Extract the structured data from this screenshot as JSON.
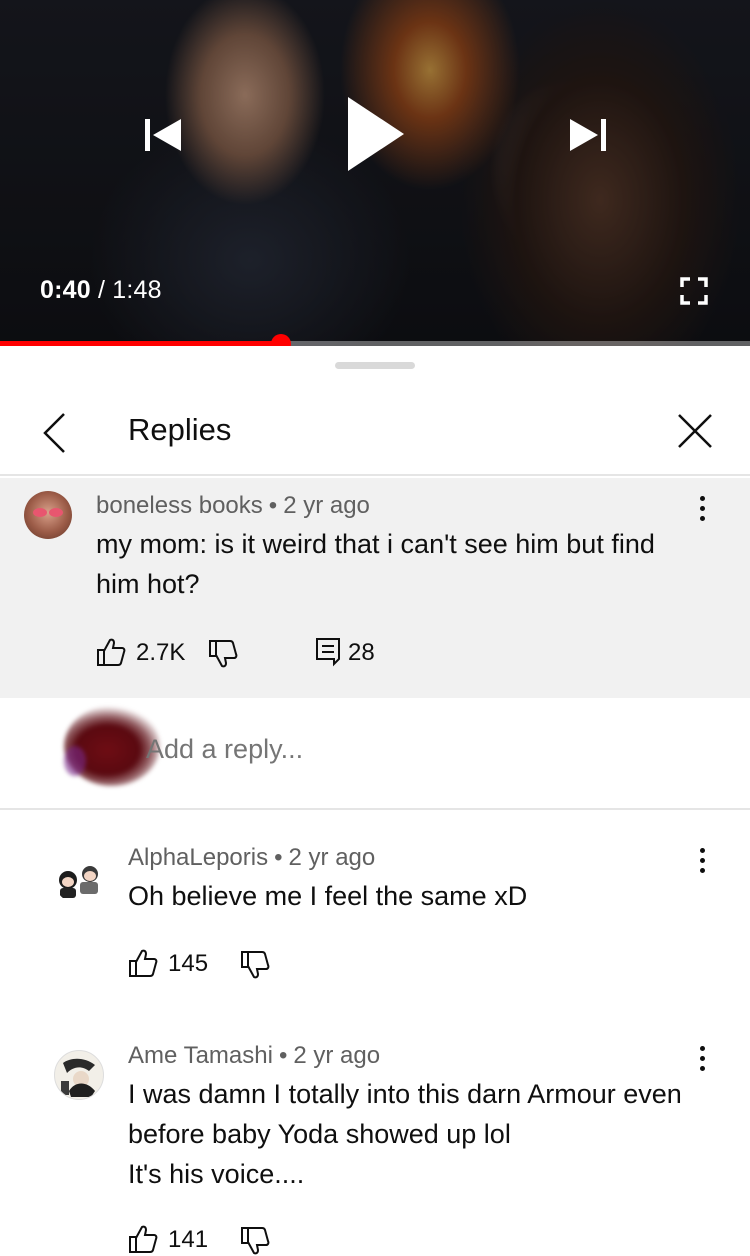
{
  "player": {
    "current_time": "0:40",
    "separator": " / ",
    "duration": "1:48",
    "progress": 0.3745,
    "accent_color": "#ff0000",
    "icons": [
      "previous-icon",
      "play-icon",
      "next-icon",
      "fullscreen-icon"
    ]
  },
  "sheet": {
    "title": "Replies",
    "icons": [
      "back-icon",
      "close-icon"
    ]
  },
  "parent_comment": {
    "author": "boneless books",
    "separator": "•",
    "age": "2 yr ago",
    "text": "my mom: is it weird that i can't see him but find him hot?",
    "likes": "2.7K",
    "replies": "28"
  },
  "reply_box": {
    "placeholder": "Add a reply..."
  },
  "replies": [
    {
      "author": "AlphaLeporis",
      "separator": "•",
      "age": "2 yr ago",
      "text": "Oh believe me I feel the same xD",
      "likes": "145"
    },
    {
      "author": "Ame Tamashi",
      "separator": "•",
      "age": "2 yr ago",
      "text_lines": [
        "I was damn I totally into this darn Armour even",
        "before baby Yoda showed up lol",
        "It's his voice...."
      ],
      "likes": "141"
    }
  ]
}
